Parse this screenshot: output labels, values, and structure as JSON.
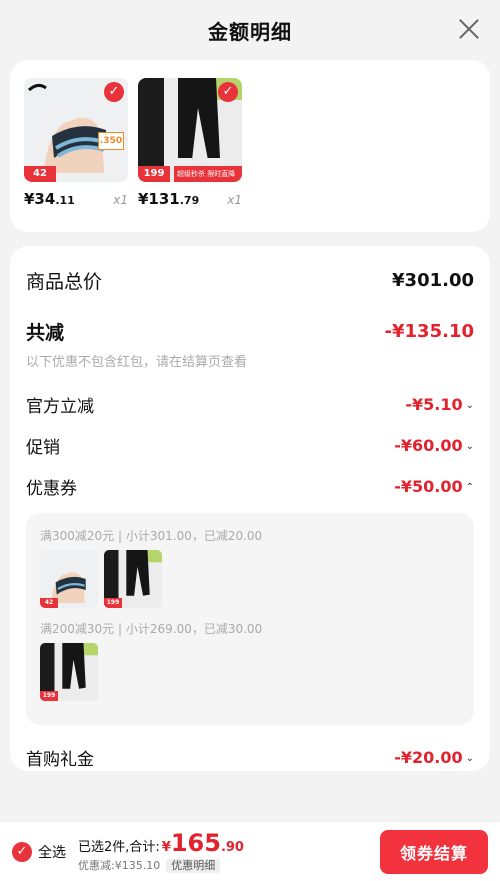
{
  "header": {
    "title": "金额明细"
  },
  "products": [
    {
      "price_int": "¥34",
      "price_dec": ".11",
      "qty": "x1",
      "badge": "42",
      "tag": ".350"
    },
    {
      "price_int": "¥131",
      "price_dec": ".79",
      "qty": "x1",
      "badge": "199",
      "promo": "超级秒杀 限时直降"
    }
  ],
  "summary": {
    "total_label": "商品总价",
    "total_amount": "¥301.00",
    "discount_label": "共减",
    "discount_amount": "-¥135.10",
    "note": "以下优惠不包含红包，请在结算页查看",
    "official_label": "官方立减",
    "official_amount": "-¥5.10",
    "promo_label": "促销",
    "promo_amount": "-¥60.00",
    "coupon_label": "优惠券",
    "coupon_amount": "-¥50.00",
    "coupon_lines": [
      "满300减20元 | 小计301.00，已减20.00",
      "满200减30元 | 小计269.00，已减30.00"
    ],
    "firstbuy_label": "首购礼金",
    "firstbuy_amount": "-¥20.00"
  },
  "bottom": {
    "select_all": "全选",
    "selected_text": "已选2件,合计:",
    "price_currency": "¥",
    "price_int": "165",
    "price_dec": ".90",
    "discount_text": "优惠减:¥135.10",
    "detail_label": "优惠明细",
    "checkout_label": "领券结算"
  },
  "colors": {
    "accent": "#e2232e"
  }
}
